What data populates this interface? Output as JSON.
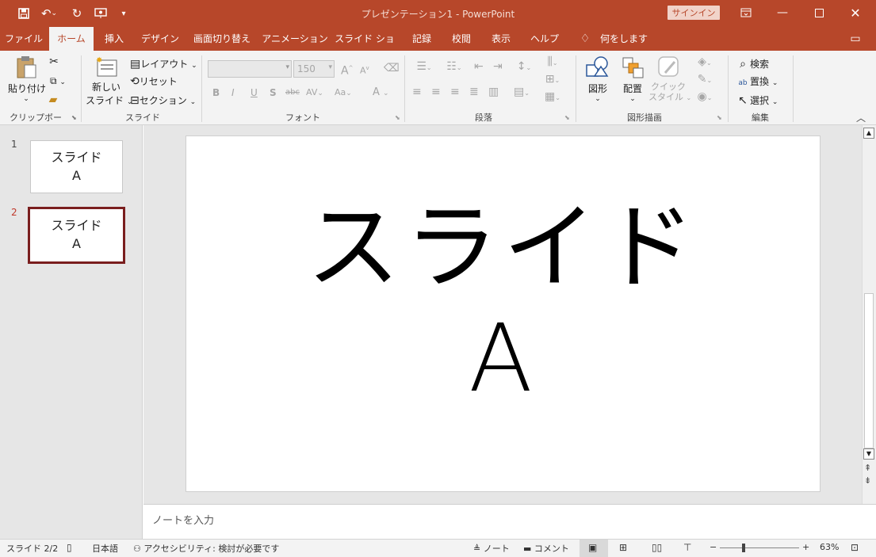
{
  "window": {
    "title": "プレゼンテーション1  -  PowerPoint",
    "signin": "サインイン",
    "minimize_icon": "minimize-icon",
    "restore_icon": "restore-icon",
    "close_icon": "close-icon"
  },
  "quick_access": [
    "save-icon",
    "undo-icon",
    "redo-icon",
    "present-icon",
    "customize-icon"
  ],
  "tabs": [
    {
      "label": "ファイル"
    },
    {
      "label": "ホーム"
    },
    {
      "label": "挿入"
    },
    {
      "label": "デザイン"
    },
    {
      "label": "画面切り替え"
    },
    {
      "label": "アニメーション"
    },
    {
      "label": "スライド ショー"
    },
    {
      "label": "記録"
    },
    {
      "label": "校閲"
    },
    {
      "label": "表示"
    },
    {
      "label": "ヘルプ"
    },
    {
      "label": "何をしますか"
    }
  ],
  "ribbon": {
    "clipboard": {
      "paste": "貼り付け",
      "group": "クリップボード"
    },
    "slides": {
      "new_line1": "新しい",
      "new_line2": "スライド",
      "layout": "レイアウト",
      "reset": "リセット",
      "section": "セクション",
      "group": "スライド"
    },
    "font": {
      "size": "150",
      "group": "フォント",
      "bold": "B",
      "italic": "I",
      "underline": "U",
      "shadow": "S",
      "strike": "abc",
      "spacing": "AV",
      "case": "Aa",
      "color": "A"
    },
    "paragraph": {
      "group": "段落"
    },
    "drawing": {
      "shape": "図形",
      "arrange": "配置",
      "quick_line1": "クイック",
      "quick_line2": "スタイル",
      "group": "図形描画"
    },
    "editing": {
      "find": "検索",
      "replace": "置換",
      "select": "選択",
      "group": "編集"
    }
  },
  "thumbnails": [
    {
      "num": "1",
      "line1": "スライド",
      "line2": "A"
    },
    {
      "num": "2",
      "line1": "スライド",
      "line2": "A"
    }
  ],
  "slide": {
    "line1": "スライド",
    "line2": "A"
  },
  "notes_placeholder": "ノートを入力",
  "status": {
    "slide": "スライド 2/2",
    "language": "日本語",
    "accessibility": "アクセシビリティ: 検討が必要です",
    "notes": "ノート",
    "comments": "コメント",
    "zoom": "63%"
  },
  "colors": {
    "accent": "#b7472a",
    "selected_thumb": "#7a1e1e"
  }
}
